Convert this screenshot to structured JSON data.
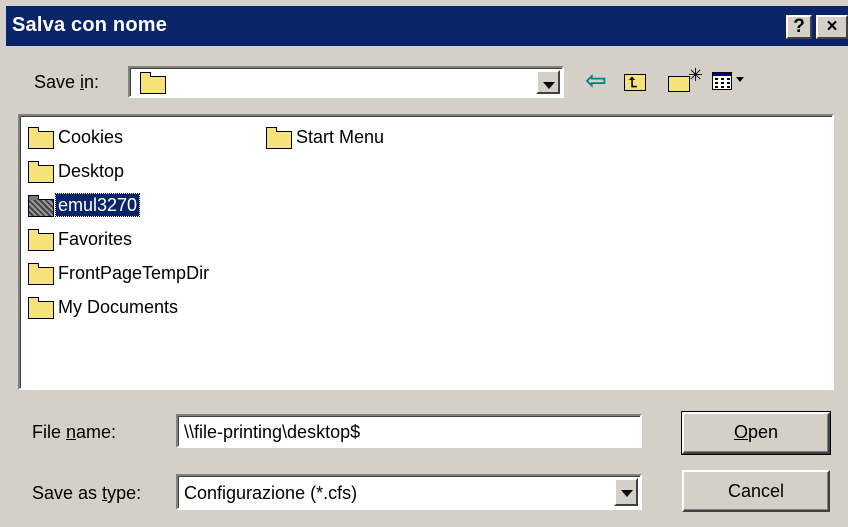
{
  "window": {
    "title": "Salva con nome",
    "help_label": "?",
    "close_label": "×"
  },
  "save_in": {
    "label_prefix": "Save ",
    "label_underlined": "i",
    "label_suffix": "n:",
    "value": ""
  },
  "toolbar": {
    "icons": [
      "back-arrow-icon",
      "up-one-level-icon",
      "create-new-folder-icon",
      "view-menu-icon"
    ]
  },
  "file_list": {
    "items": [
      {
        "label": "Cookies",
        "icon": "folder-icon",
        "selected": false
      },
      {
        "label": "Desktop",
        "icon": "folder-icon",
        "selected": false
      },
      {
        "label": "emul3270",
        "icon": "folder-icon",
        "selected": true
      },
      {
        "label": "Favorites",
        "icon": "folder-icon",
        "selected": false
      },
      {
        "label": "FrontPageTempDir",
        "icon": "folder-icon",
        "selected": false
      },
      {
        "label": "My Documents",
        "icon": "folder-icon",
        "selected": false
      },
      {
        "label": "Start Menu",
        "icon": "folder-icon",
        "selected": false
      }
    ]
  },
  "file_name": {
    "label_prefix": "File ",
    "label_underlined": "n",
    "label_suffix": "ame:",
    "value": "\\\\file-printing\\desktop$"
  },
  "save_as_type": {
    "label_prefix": "Save as ",
    "label_underlined": "t",
    "label_suffix": "ype:",
    "value": "Configurazione (*.cfs)"
  },
  "buttons": {
    "open_underlined": "O",
    "open_rest": "pen",
    "cancel": "Cancel"
  },
  "colors": {
    "titlebar": "#0a246a",
    "face": "#d4d0c8",
    "selection": "#0a246a"
  }
}
